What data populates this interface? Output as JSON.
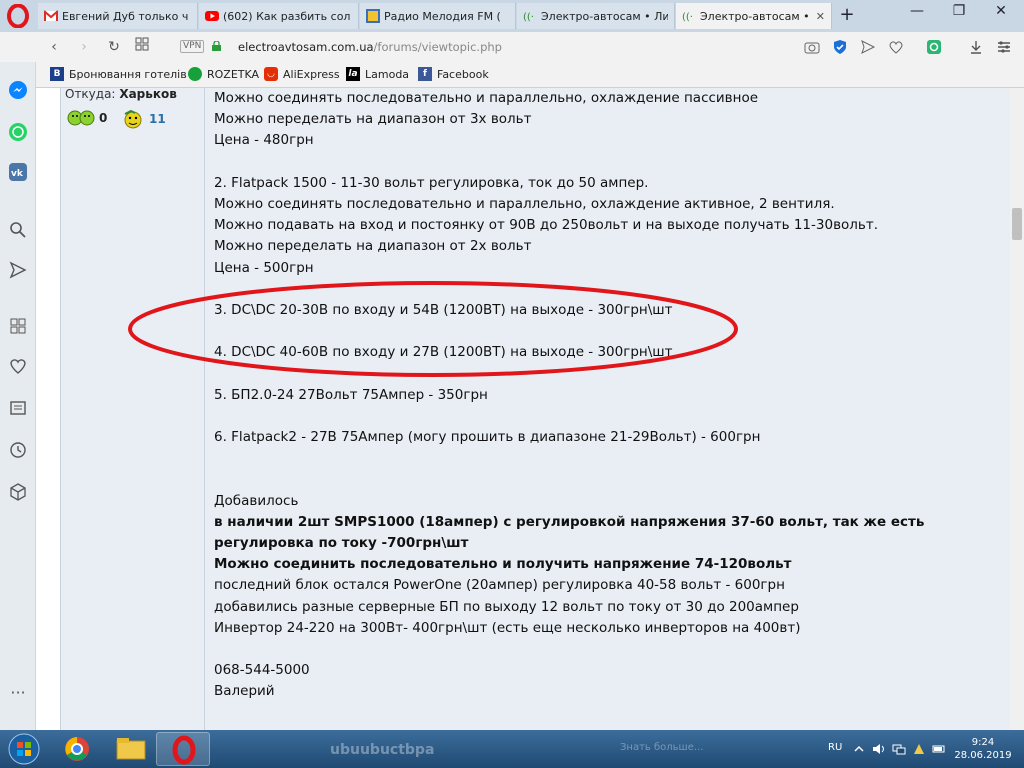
{
  "browser": {
    "tabs": [
      {
        "title": "Евгений Дуб только ч",
        "favicon": "gmail-icon"
      },
      {
        "title": "(602) Как разбить сол",
        "favicon": "youtube-icon"
      },
      {
        "title": "Радио Мелодия FM (",
        "favicon": "radio-icon"
      },
      {
        "title": "Электро-автосам • Ли",
        "favicon": "site-icon"
      },
      {
        "title": "Электро-автосам • Пр",
        "favicon": "site-icon",
        "active": true
      }
    ],
    "vpn_label": "VPN",
    "url_host": "electroavtosam.com.ua",
    "url_path": "/forums/viewtopic.php",
    "bookmarks": [
      {
        "label": "Бронювання готелів",
        "icon": "booking-icon"
      },
      {
        "label": "ROZETKA",
        "icon": "rozetka-icon"
      },
      {
        "label": "AliExpress",
        "icon": "aliexpress-icon"
      },
      {
        "label": "Lamoda",
        "icon": "lamoda-icon"
      },
      {
        "label": "Facebook",
        "icon": "facebook-icon"
      }
    ]
  },
  "post": {
    "from_label": "Откуда:",
    "from_value": "Харьков",
    "stat_1": "0",
    "stat_2": "11",
    "lines": [
      {
        "text": "Можно соединять последовательно и параллельно, охлаждение пассивное"
      },
      {
        "text": "Можно переделать на диапазон от 3х вольт"
      },
      {
        "text": "Цена - 480грн"
      },
      {
        "text": ""
      },
      {
        "text": "2. Flatpack 1500 - 11-30 вольт регулировка, ток до 50 ампер."
      },
      {
        "text": "Можно соединять последовательно и параллельно, охлаждение активное, 2 вентиля."
      },
      {
        "text": "Можно подавать на вход и постоянку от 90В до 250вольт и на выходе получать 11-30вольт."
      },
      {
        "text": "Можно переделать на диапазон от 2х вольт"
      },
      {
        "text": "Цена - 500грн"
      },
      {
        "text": ""
      },
      {
        "text": "3. DC\\DC 20-30В по входу и 54В (1200ВТ) на выходе - 300грн\\шт"
      },
      {
        "text": ""
      },
      {
        "text": "4. DC\\DC 40-60В по входу и 27В (1200ВТ) на выходе - 300грн\\шт"
      },
      {
        "text": ""
      },
      {
        "text": "5. БП2.0-24 27Вольт 75Ампер - 350грн"
      },
      {
        "text": ""
      },
      {
        "text": "6. Flatpack2 - 27В 75Ампер (могу прошить в диапазоне 21-29Вольт) - 600грн"
      },
      {
        "text": ""
      },
      {
        "text": ""
      },
      {
        "text": "Добавилось"
      },
      {
        "text": "в наличии 2шт SMPS1000 (18ампер) с регулировкой напряжения 37-60 вольт, так же есть",
        "bold": true
      },
      {
        "text": "регулировка по току -700грн\\шт",
        "bold": true
      },
      {
        "text": "Можно соединить последовательно и получить напряжение 74-120вольт",
        "bold": true
      },
      {
        "text": "последний блок остался PowerOne (20ампер) регулировка 40-58 вольт - 600грн"
      },
      {
        "text": "добавились разные серверные БП по выходу 12 вольт по току от 30 до 200ампер"
      },
      {
        "text": "Инвертор 24-220 на 300Вт- 400грн\\шт (есть еще несколько инверторов на 400вт)"
      },
      {
        "text": ""
      },
      {
        "text": "068-544-5000"
      },
      {
        "text": "Валерий"
      }
    ]
  },
  "taskbar": {
    "lang": "RU",
    "time": "9:24",
    "date": "28.06.2019",
    "ghost_1": "ubuubuctbpa",
    "ghost_2": "Знать больше..."
  },
  "colors": {
    "accent_red": "#e0161b",
    "post_bg": "#e8eef4",
    "tab_active": "#f2f2f2"
  }
}
